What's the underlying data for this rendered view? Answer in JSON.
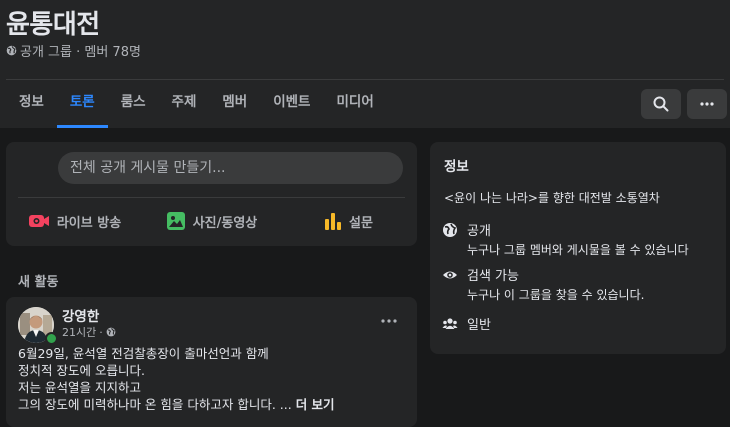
{
  "group": {
    "name": "윤통대전",
    "meta": "공개 그룹 · 멤버 78명"
  },
  "tabs": [
    {
      "label": "정보",
      "active": false
    },
    {
      "label": "토론",
      "active": true
    },
    {
      "label": "룸스",
      "active": false
    },
    {
      "label": "주제",
      "active": false
    },
    {
      "label": "멤버",
      "active": false
    },
    {
      "label": "이벤트",
      "active": false
    },
    {
      "label": "미디어",
      "active": false
    }
  ],
  "header_buttons": {
    "search_icon": "search-icon",
    "more_icon": "more-icon"
  },
  "composer": {
    "placeholder": "전체 공개 게시물 만들기...",
    "actions": [
      {
        "label": "라이브 방송",
        "icon": "live-video-icon",
        "color": "#f3425f"
      },
      {
        "label": "사진/동영상",
        "icon": "photo-video-icon",
        "color": "#45bd62"
      },
      {
        "label": "설문",
        "icon": "poll-icon",
        "color": "#f7b928"
      }
    ]
  },
  "feed": {
    "section_label": "새 활동",
    "post": {
      "author": "강영한",
      "time": "21시간",
      "lines": [
        "6월29일, 윤석열 전검찰총장이 출마선언과 함께",
        "정치적 장도에 오릅니다.",
        "저는 윤석열을 지지하고",
        "그의 장도에 미력하나마 온 힘을 다하고자 합니다. ..."
      ],
      "see_more": "더 보기"
    }
  },
  "about": {
    "title": "정보",
    "description": "<윤이 나는 나라>를 향한 대전발 소통열차",
    "items": [
      {
        "icon": "globe-icon",
        "title": "공개",
        "subtitle": "누구나 그룹 멤버와 게시물을 볼 수 있습니다"
      },
      {
        "icon": "eye-icon",
        "title": "검색 가능",
        "subtitle": "누구나 이 그룹을 찾을 수 있습니다."
      },
      {
        "icon": "members-icon",
        "title": "일반",
        "subtitle": ""
      }
    ]
  },
  "colors": {
    "background": "#18191a",
    "card": "#242526",
    "accent": "#2d88ff",
    "text": "#e4e6eb",
    "secondary_text": "#b0b3b8"
  }
}
